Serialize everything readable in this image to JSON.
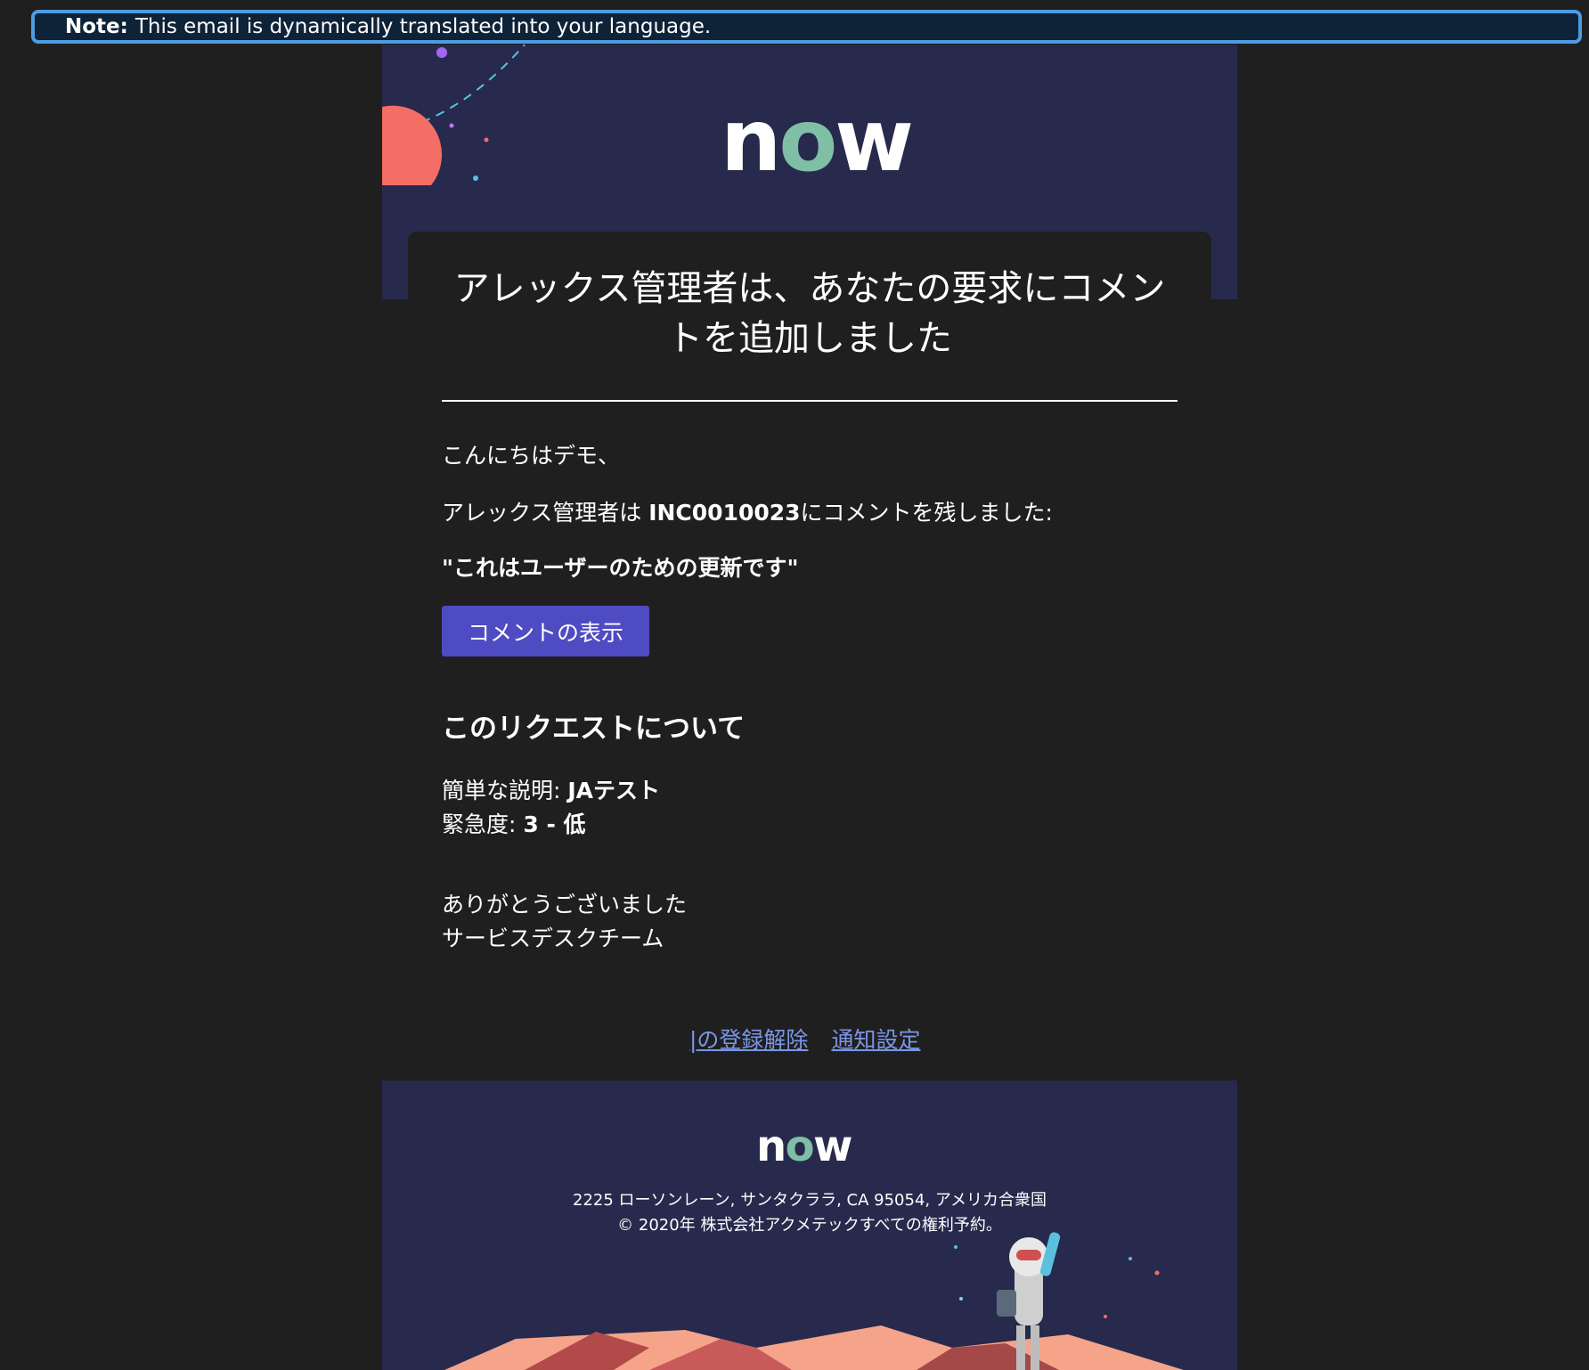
{
  "note": {
    "label": "Note:",
    "text": "This email is dynamically translated into your language."
  },
  "brand": {
    "logo_n": "n",
    "logo_o": "o",
    "logo_w": "w"
  },
  "email": {
    "title": "アレックス管理者は、あなたの要求にコメントを追加しました",
    "greeting": "こんにちはデモ、",
    "comment_prefix": "アレックス管理者は ",
    "incident_number": "INC0010023",
    "comment_suffix": "にコメントを残しました:",
    "quote": "\"これはユーザーのための更新です\"",
    "view_button": "コメントの表示",
    "section_title": "このリクエストについて",
    "short_desc_label": "簡単な説明: ",
    "short_desc_value": "JAテスト",
    "urgency_label": "緊急度: ",
    "urgency_value": "3 - 低",
    "thanks": "ありがとうございました",
    "team": "サービスデスクチーム"
  },
  "links": {
    "unsubscribe": "|の登録解除",
    "preferences": "通知設定"
  },
  "footer": {
    "address": "2225 ローソンレーン, サンタクララ, CA 95054, アメリカ合衆国",
    "copyright": "© 2020年 株式会社アクメテックすべての権利予約。"
  },
  "colors": {
    "page_bg": "#1f1f1f",
    "band_bg": "#272a4c",
    "note_border": "#4d9ce0",
    "button": "#4f4bc2",
    "link": "#7b96e6",
    "logo_o": "#7fbfa6",
    "accent_coral": "#f46e66"
  }
}
